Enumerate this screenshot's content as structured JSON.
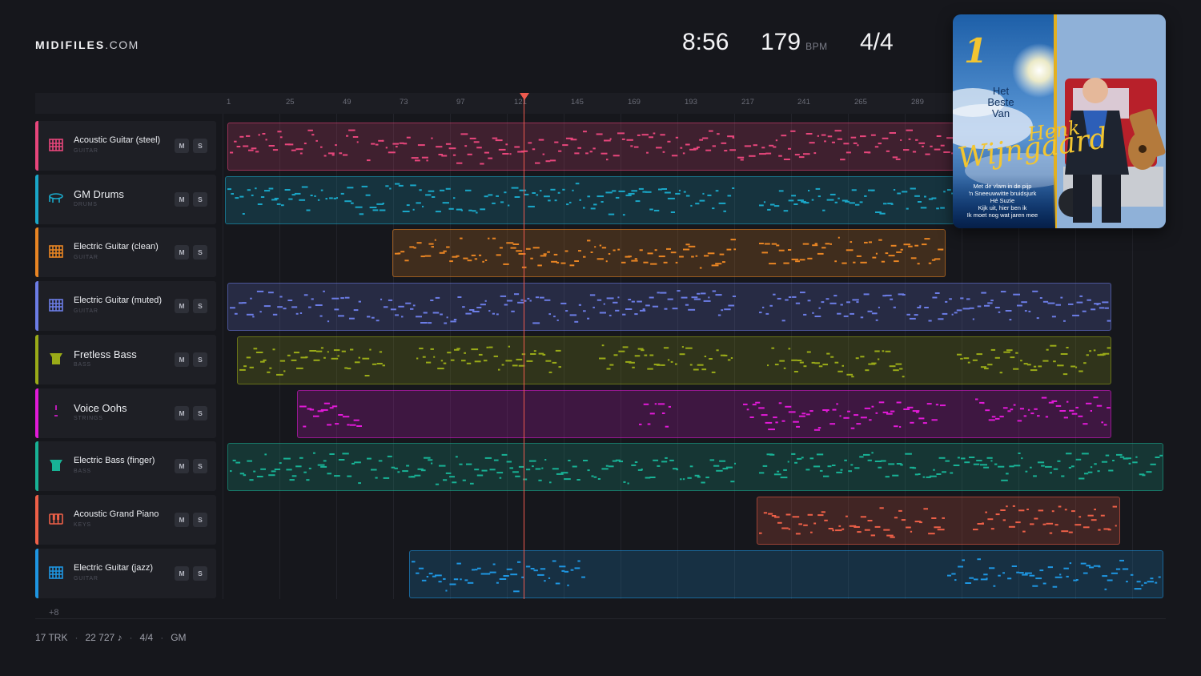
{
  "brand": {
    "bold": "MIDIFILES",
    "light": ".COM"
  },
  "stats": {
    "duration": "8:56",
    "bpm": "179",
    "bpm_unit": "BPM",
    "time_signature": "4/4"
  },
  "ruler": {
    "ticks": [
      "1",
      "25",
      "49",
      "73",
      "97",
      "121",
      "145",
      "169",
      "193",
      "217",
      "241",
      "265",
      "289"
    ]
  },
  "tracks": [
    {
      "name": "Acoustic Guitar (steel)",
      "category": "GUITAR",
      "icon": "guitar-grid-icon",
      "color": "#e8467c",
      "mute": "M",
      "solo": "S"
    },
    {
      "name": "GM Drums",
      "category": "DRUMS",
      "icon": "drum-icon",
      "color": "#1aa7c8",
      "mute": "M",
      "solo": "S"
    },
    {
      "name": "Electric Guitar (clean)",
      "category": "GUITAR",
      "icon": "guitar-grid-icon",
      "color": "#e98523",
      "mute": "M",
      "solo": "S"
    },
    {
      "name": "Electric Guitar (muted)",
      "category": "GUITAR",
      "icon": "guitar-grid-icon",
      "color": "#6c7de6",
      "mute": "M",
      "solo": "S"
    },
    {
      "name": "Fretless Bass",
      "category": "BASS",
      "icon": "bass-icon",
      "color": "#9aab18",
      "mute": "M",
      "solo": "S"
    },
    {
      "name": "Voice Oohs",
      "category": "STRINGS",
      "icon": "violin-icon",
      "color": "#e21ad8",
      "mute": "M",
      "solo": "S"
    },
    {
      "name": "Electric Bass (finger)",
      "category": "BASS",
      "icon": "bass-icon",
      "color": "#18b295",
      "mute": "M",
      "solo": "S"
    },
    {
      "name": "Acoustic Grand Piano",
      "category": "KEYS",
      "icon": "piano-icon",
      "color": "#ee6048",
      "mute": "M",
      "solo": "S"
    },
    {
      "name": "Electric Guitar (jazz)",
      "category": "GUITAR",
      "icon": "guitar-grid-icon",
      "color": "#1e96e2",
      "mute": "M",
      "solo": "S"
    }
  ],
  "more_tracks": "+8",
  "footer": {
    "tracks": "17 TRK",
    "notes": "22 727 ♪",
    "time_signature": "4/4",
    "standard": "GM"
  },
  "album": {
    "number": "1",
    "title_line1": "Het",
    "title_line2": "Beste",
    "title_line3": "Van",
    "artist_first": "Henk",
    "artist_last": "Wijngaard",
    "songs": [
      "Met de vlam in de pijp",
      "'n Sneeuwwitte bruidsjurk",
      "Hé Suzie",
      "Kijk uit, hier ben ik",
      "Ik moet nog wat jaren mee"
    ]
  }
}
